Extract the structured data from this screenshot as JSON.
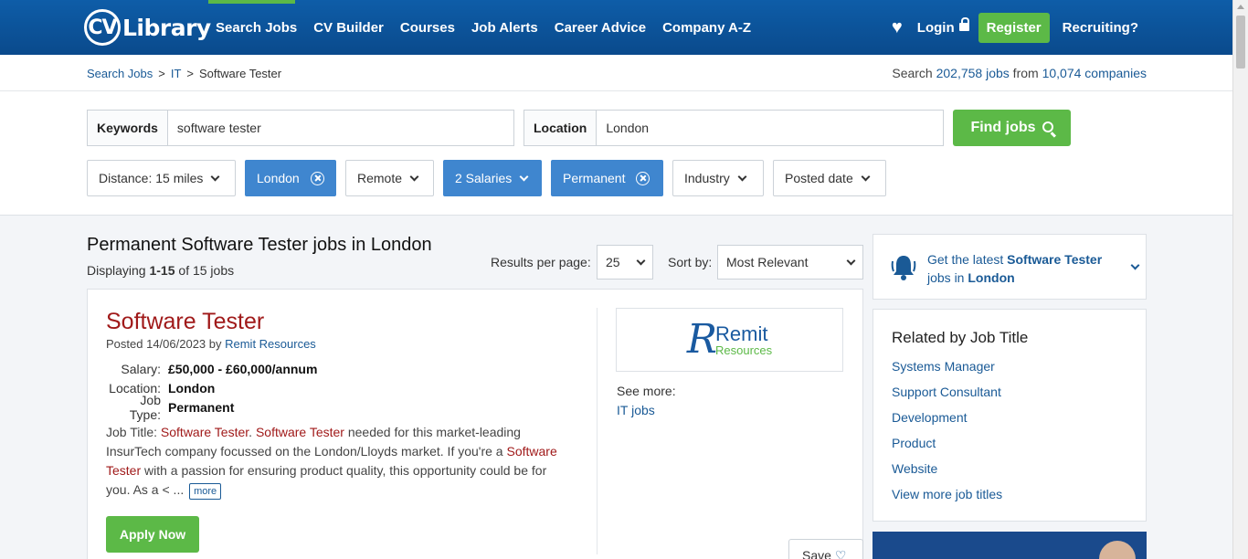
{
  "header": {
    "logo_cv": "CV",
    "logo_library": "Library",
    "nav": [
      "Search Jobs",
      "CV Builder",
      "Courses",
      "Job Alerts",
      "Career Advice",
      "Company A-Z"
    ],
    "login": "Login",
    "register": "Register",
    "recruiting": "Recruiting?"
  },
  "breadcrumb": {
    "items": [
      "Search Jobs",
      "IT",
      "Software Tester"
    ],
    "sep": ">"
  },
  "stats": {
    "prefix": "Search ",
    "jobs": "202,758 jobs",
    "middle": " from ",
    "companies": "10,074 companies"
  },
  "search": {
    "keywords_label": "Keywords",
    "keywords_value": "software tester",
    "location_label": "Location",
    "location_value": "London",
    "find_label": "Find jobs"
  },
  "filters": [
    "Distance: 15 miles",
    "London",
    "Remote",
    "2 Salaries",
    "Permanent",
    "Industry",
    "Posted date"
  ],
  "results": {
    "title": "Permanent Software Tester jobs in London",
    "displaying_prefix": "Displaying ",
    "displaying_range": "1-15",
    "displaying_suffix": " of 15 jobs",
    "rpp_label": "Results per page:",
    "rpp_value": "25",
    "sort_label": "Sort by:",
    "sort_value": "Most Relevant"
  },
  "job": {
    "title": "Software Tester",
    "posted_prefix": "Posted 14/06/2023 by ",
    "company": "Remit Resources",
    "salary_label": "Salary:",
    "salary_value": "£50,000 - £60,000/annum",
    "location_label": "Location:",
    "location_value": "London",
    "type_label": "Job Type:",
    "type_value": "Permanent",
    "desc_1": "Job Title: ",
    "desc_hl1": "Software Tester",
    "desc_2": ". ",
    "desc_hl2": "Software Tester",
    "desc_3": " needed for this market-leading InsurTech company focussed on the London/Lloyds market. If you're a ",
    "desc_hl3": "Software Tester",
    "desc_4": " with a passion for ensuring product quality, this opportunity could be for you. As a < ... ",
    "more": "more",
    "apply": "Apply Now",
    "logo_word1": "Remit",
    "logo_word2": "Resources",
    "see_more": "See more:",
    "it_jobs": "IT jobs",
    "save": "Save"
  },
  "sidebar": {
    "alert_prefix": "Get the latest ",
    "alert_keyword": "Software Tester",
    "alert_middle": " jobs in ",
    "alert_location": "London",
    "related_title": "Related by Job Title",
    "related": [
      "Systems Manager",
      "Support Consultant",
      "Development",
      "Product",
      "Website",
      "View more job titles"
    ]
  },
  "colors": {
    "brand_blue": "#0e5da8",
    "green": "#5cb947",
    "filter_active": "#3f86cf",
    "job_title_red": "#a01a1a"
  }
}
